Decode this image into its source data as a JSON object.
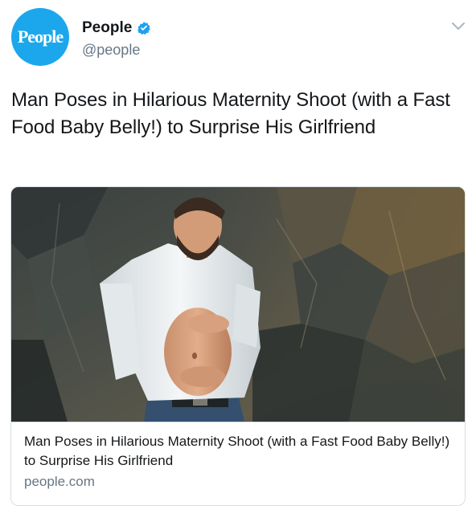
{
  "author": {
    "avatar_text": "People",
    "display_name": "People",
    "handle": "@people",
    "verified": true,
    "avatar_color": "#1ca7ec",
    "verified_color": "#1da1f2"
  },
  "tweet": {
    "text": "Man Poses in Hilarious Maternity Shoot (with a Fast Food Baby Belly!) to Surprise His Girlfriend"
  },
  "card": {
    "image_description_icon": "photo-man-maternity-shoot",
    "title": "Man Poses in Hilarious Maternity Shoot (with a Fast Food Baby Belly!) to Surprise His Girlfriend",
    "domain": "people.com"
  },
  "icons": {
    "menu": "chevron-down-icon",
    "verified": "verified-badge-icon"
  }
}
